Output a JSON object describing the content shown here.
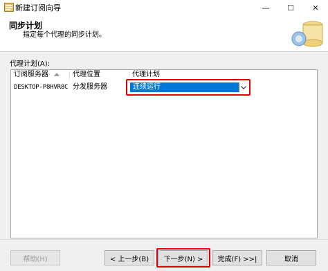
{
  "window": {
    "title": "新建订阅向导",
    "minimize_glyph": "—",
    "maximize_glyph": "☐",
    "close_glyph": "✕"
  },
  "header": {
    "title": "同步计划",
    "subtitle": "指定每个代理的同步计划。",
    "art_icon": "database-wizard-icon"
  },
  "agent_schedule": {
    "label": "代理计划(A):",
    "columns": [
      "订阅服务器",
      "代理位置",
      "代理计划"
    ],
    "sort_icon": "sort-ascending-icon",
    "rows": [
      {
        "subscriber": "DESKTOP-P8HVR8C",
        "location": "分发服务器",
        "schedule": "连续运行"
      }
    ],
    "dropdown_icon": "chevron-down-icon"
  },
  "footer": {
    "help": "帮助(H)",
    "back": "< 上一步(B)",
    "next": "下一步(N) >",
    "finish": "完成(F) >>|",
    "cancel": "取消"
  },
  "colors": {
    "selection": "#0078d7",
    "highlight_box": "#e00000"
  }
}
